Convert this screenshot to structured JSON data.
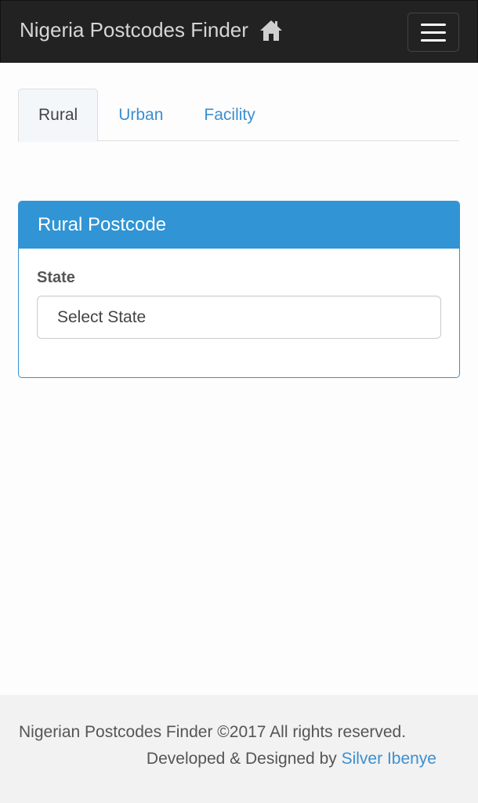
{
  "navbar": {
    "brand": "Nigeria Postcodes Finder",
    "home_icon": "home-icon",
    "menu_icon": "hamburger-menu-icon"
  },
  "tabs": [
    {
      "label": "Rural",
      "active": true
    },
    {
      "label": "Urban",
      "active": false
    },
    {
      "label": "Facility",
      "active": false
    }
  ],
  "panel": {
    "title": "Rural Postcode",
    "state_label": "State",
    "state_select_value": "Select State"
  },
  "footer": {
    "copyright": "Nigerian Postcodes Finder ©2017 All rights reserved.",
    "developed_prefix": "Developed & Designed by",
    "developer_name": "Silver Ibenye"
  },
  "colors": {
    "navbar_bg": "#222222",
    "panel_header": "#3194d4",
    "link": "#3b8fd0",
    "footer_bg": "#f2f2f2"
  }
}
